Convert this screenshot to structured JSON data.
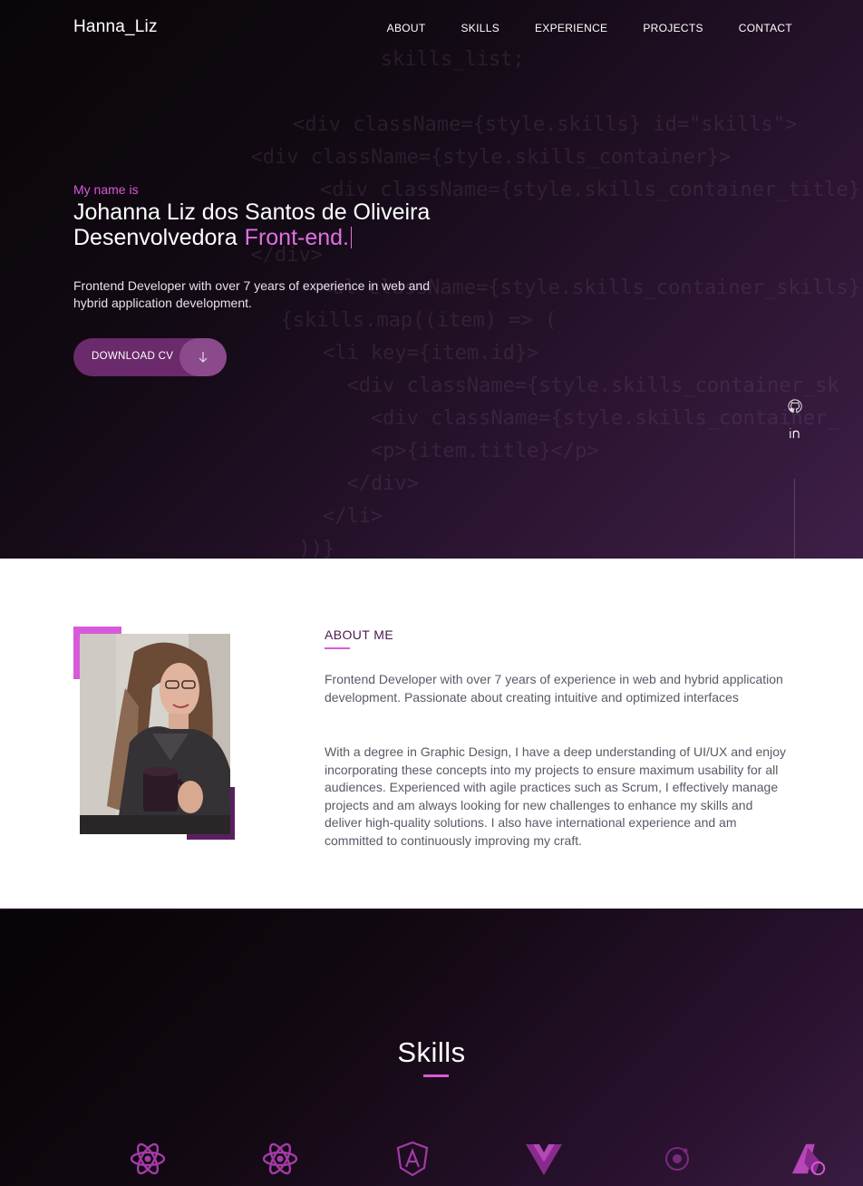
{
  "header": {
    "logo": "Hanna_Liz",
    "nav": [
      "ABOUT",
      "SKILLS",
      "EXPERIENCE",
      "PROJECTS",
      "CONTACT"
    ]
  },
  "hero": {
    "intro": "My name is",
    "name": "Johanna Liz dos Santos de Oliveira",
    "role_prefix": "Desenvolvedora",
    "role_accent": "Front-end.",
    "description": "Frontend Developer with over 7 years of experience in web and hybrid application development.",
    "cv_button": "DOWNLOAD CV",
    "code_lines": [
      "    <div className={style.skills} id=\"skills\">",
      "  <div className={style.skills_container}>",
      "    <div className={style.skills_container_title} da",
      "  </div>",
      "    <ul className={style.skills_container_skills} c",
      "      {skills.map((item) => (",
      "        <li key={item.id}>",
      "          <div className={style.skills_container_sk",
      "            <div className={style.skills_container_",
      "            <p>{item.title}</p>",
      "          </div>",
      "        </li>",
      "      ))}"
    ],
    "code_top_line": "   skills_list;"
  },
  "social": {
    "github_icon": "github-icon",
    "linkedin_icon": "linkedin-icon"
  },
  "about": {
    "title": "ABOUT ME",
    "paragraph1": "Frontend Developer with over 7 years of experience in web and hybrid application development. Passionate about creating intuitive and optimized interfaces",
    "paragraph2": "With a degree in Graphic Design, I have a deep understanding of UI/UX and enjoy incorporating these concepts into my projects to ensure maximum usability for all audiences. Experienced with agile practices such as Scrum, I effectively manage projects and am always looking for new challenges to enhance my skills and deliver high-quality solutions. I also have international experience and am committed to continuously improving my craft."
  },
  "skills": {
    "title": "Skills",
    "icons": [
      "react-icon",
      "react-native-icon",
      "angular-icon",
      "vue-icon",
      "ionic-icon",
      "figma-adobe-icon"
    ]
  },
  "colors": {
    "accent": "#d75bd8",
    "dark_purple": "#5a1f5e",
    "button": "#6b2a6b"
  }
}
